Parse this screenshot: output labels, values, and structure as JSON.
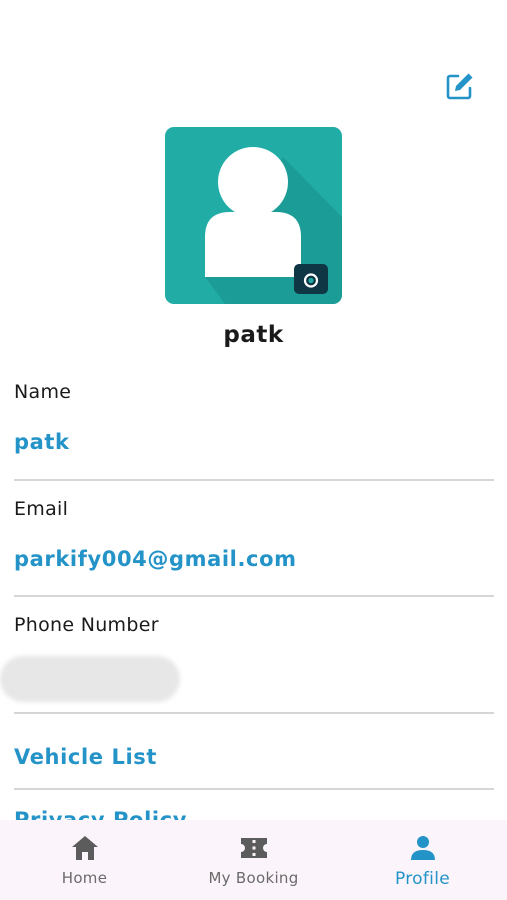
{
  "profile": {
    "username": "patk"
  },
  "fields": [
    {
      "label": "Name",
      "value": "patk"
    },
    {
      "label": "Email",
      "value": "parkify004@gmail.com"
    },
    {
      "label": "Phone Number",
      "value": ""
    }
  ],
  "links": {
    "vehicle_list": "Vehicle List",
    "privacy_policy": "Privacy Policy"
  },
  "nav": [
    {
      "label": "Home",
      "icon": "home-icon",
      "active": false
    },
    {
      "label": "My Booking",
      "icon": "ticket-icon",
      "active": false
    },
    {
      "label": "Profile",
      "icon": "person-icon",
      "active": true
    }
  ],
  "colors": {
    "accent": "#2493c7",
    "avatar_bg": "#21aca6",
    "nav_bg": "#fbf4fb"
  }
}
